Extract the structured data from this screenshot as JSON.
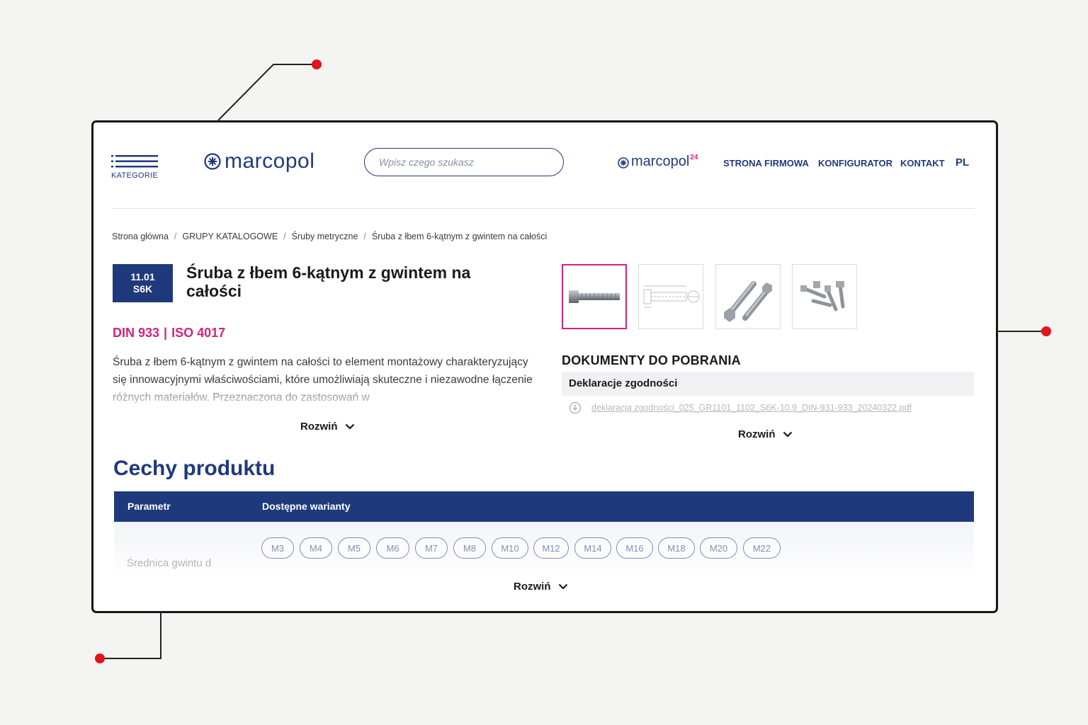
{
  "header": {
    "menu_label": "KATEGORIE",
    "logo_text": "marcopol",
    "search_placeholder": "Wpisz czego szukasz",
    "logo24_text": "marcopol",
    "logo24_sup": "24",
    "nav": [
      "STRONA FIRMOWA",
      "KONFIGURATOR",
      "KONTAKT",
      "PL"
    ]
  },
  "breadcrumb": [
    "Strona główna",
    "GRUPY KATALOGOWE",
    "Śruby metryczne",
    "Śruba z łbem 6-kątnym z gwintem na całości"
  ],
  "product": {
    "code_line1": "11.01",
    "code_line2": "S6K",
    "title": "Śruba z łbem 6-kątnym z gwintem na całości",
    "standard1": "DIN 933",
    "standard_sep": "|",
    "standard2": "ISO 4017",
    "description": "Śruba z łbem 6-kątnym z gwintem na całości to element montażowy charakteryzujący się innowacyjnymi właściwościami, które umożliwiają skuteczne i niezawodne łączenie różnych materiałów. Przeznaczona do zastosowań w",
    "expand_label": "Rozwiń"
  },
  "gallery": [
    "bolt-side-view",
    "bolt-technical-drawing",
    "two-bolts-angled",
    "bolt-set"
  ],
  "documents": {
    "title": "DOKUMENTY DO POBRANIA",
    "section": "Deklaracje zgodności",
    "file": "deklaracja zgodności_025_GR1101_1102_S6K-10.9_DIN-931-933_20240322.pdf",
    "expand_label": "Rozwiń"
  },
  "features": {
    "heading": "Cechy produktu",
    "col_param": "Parametr",
    "col_variants": "Dostępne warianty",
    "row_label": "Średnica gwintu d",
    "variants": [
      "M3",
      "M4",
      "M5",
      "M6",
      "M7",
      "M8",
      "M10",
      "M12",
      "M14",
      "M16",
      "M18",
      "M20",
      "M22"
    ],
    "expand_label": "Rozwiń"
  },
  "colors": {
    "brand": "#1f3a7c",
    "accent": "#d0237c",
    "marker": "#e3141b"
  }
}
